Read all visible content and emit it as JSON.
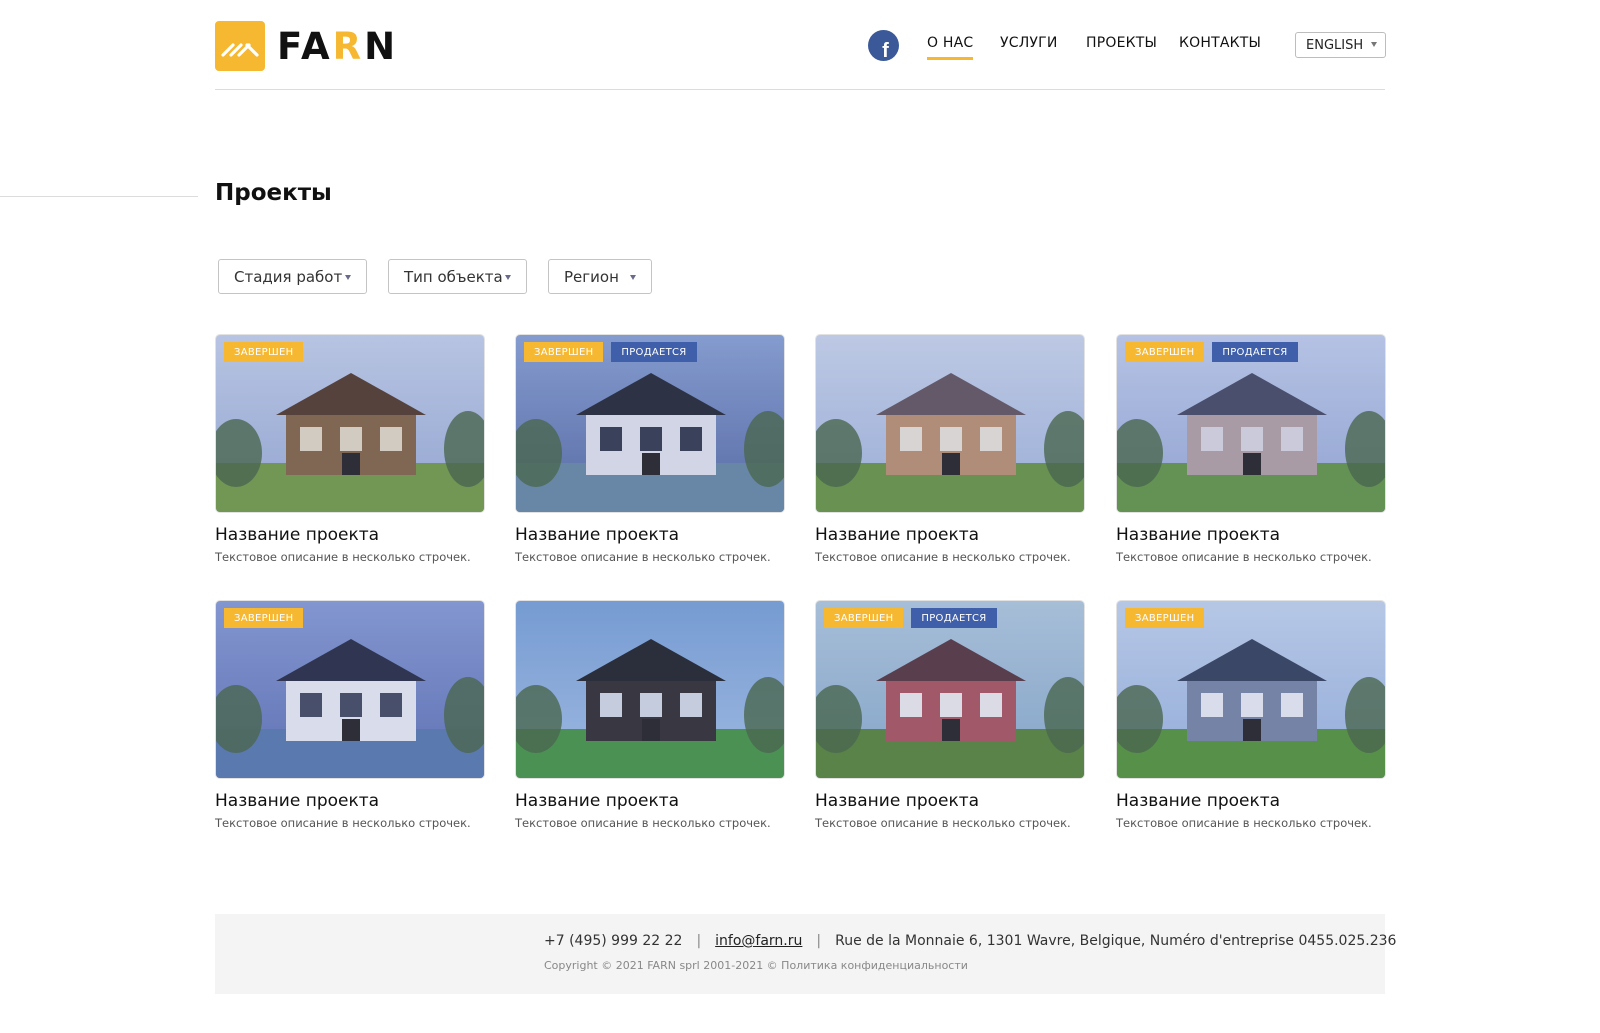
{
  "header": {
    "logo": {
      "text_part1": "FA",
      "text_accent": "R",
      "text_part2": "N"
    },
    "nav": [
      {
        "label": "О НАС",
        "active": true
      },
      {
        "label": "УСЛУГИ",
        "active": false
      },
      {
        "label": "ПРОЕКТЫ",
        "active": false
      },
      {
        "label": "КОНТАКТЫ",
        "active": false
      }
    ],
    "language": "ENGLISH",
    "social_icon": "facebook-icon"
  },
  "page": {
    "title": "Проекты"
  },
  "filters": [
    {
      "label": "Стадия работ"
    },
    {
      "label": "Тип объекта"
    },
    {
      "label": "Регион"
    }
  ],
  "badge_labels": {
    "done": "ЗАВЕРШЕН",
    "sale": "ПРОДАЕТСЯ"
  },
  "projects": [
    {
      "title": "Название проекта",
      "description": "Текстовое описание в несколько строчек.",
      "badges": [
        "done"
      ]
    },
    {
      "title": "Название проекта",
      "description": "Текстовое описание в несколько строчек.",
      "badges": [
        "done",
        "sale"
      ]
    },
    {
      "title": "Название проекта",
      "description": "Текстовое описание в несколько строчек.",
      "badges": []
    },
    {
      "title": "Название проекта",
      "description": "Текстовое описание в несколько строчек.",
      "badges": [
        "done",
        "sale"
      ]
    },
    {
      "title": "Название проекта",
      "description": "Текстовое описание в несколько строчек.",
      "badges": [
        "done"
      ]
    },
    {
      "title": "Название проекта",
      "description": "Текстовое описание в несколько строчек.",
      "badges": []
    },
    {
      "title": "Название проекта",
      "description": "Текстовое описание в несколько строчек.",
      "badges": [
        "done",
        "sale"
      ]
    },
    {
      "title": "Название проекта",
      "description": "Текстовое описание в несколько строчек.",
      "badges": [
        "done"
      ]
    }
  ],
  "footer": {
    "phone": "+7 (495) 999 22 22",
    "separator": "|",
    "email": "info@farn.ru",
    "address": "Rue de la Monnaie 6, 1301 Wavre, Belgique, Numéro d'entreprise  0455.025.236",
    "copyright": "Copyright © 2021 FARN sprl  2001-2021 © Политика конфиденциальности"
  },
  "colors": {
    "accent": "#f6b830",
    "sale_badge": "#3f5faa",
    "facebook": "#3b5998"
  }
}
